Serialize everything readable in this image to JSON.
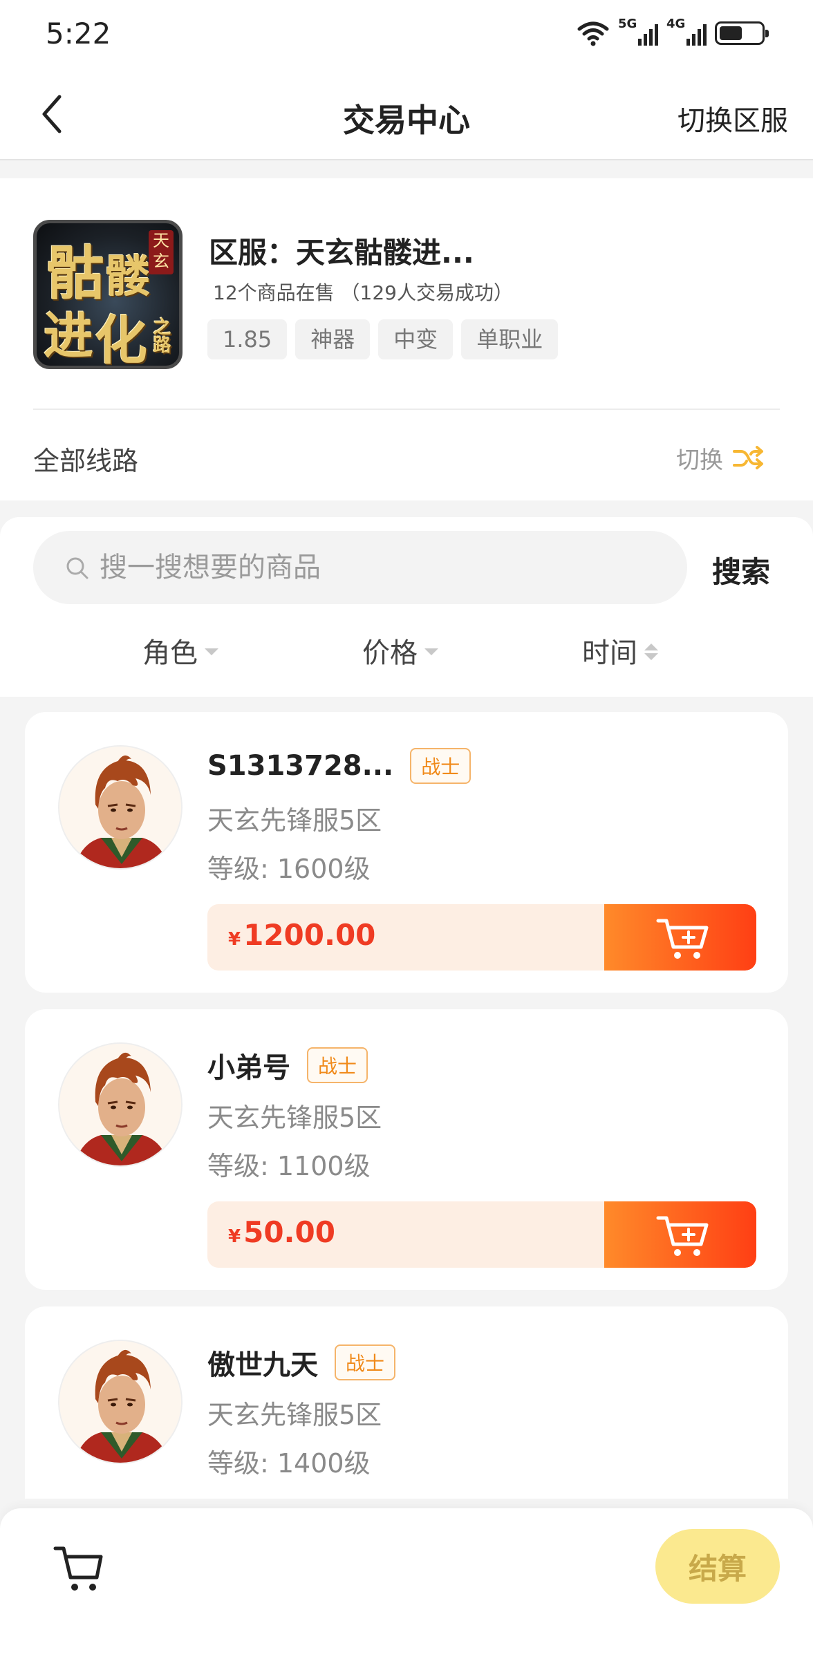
{
  "status": {
    "time": "5:22",
    "net1": "5G",
    "net2": "4G",
    "battery_level": 0.55
  },
  "nav": {
    "title": "交易中心",
    "right_action": "切换区服"
  },
  "server": {
    "logo_text": [
      "骷",
      "髅",
      "进",
      "化"
    ],
    "logo_badge": "天玄",
    "logo_sub": "之路",
    "name": "区服：天玄骷髅进...",
    "stats": "12个商品在售 （129人交易成功）",
    "tags": [
      "1.85",
      "神器",
      "中变",
      "单职业"
    ],
    "lines_label": "全部线路",
    "switch_label": "切换"
  },
  "search": {
    "placeholder": "搜一搜想要的商品",
    "value": "",
    "button": "搜索"
  },
  "sorts": [
    {
      "label": "角色"
    },
    {
      "label": "价格"
    },
    {
      "label": "时间"
    }
  ],
  "products": [
    {
      "name": "S1313728...",
      "role": "战士",
      "server": "天玄先锋服5区",
      "level": "等级: 1600级",
      "currency": "¥",
      "price": "1200.00"
    },
    {
      "name": "小弟号",
      "role": "战士",
      "server": "天玄先锋服5区",
      "level": "等级: 1100级",
      "currency": "¥",
      "price": "50.00"
    },
    {
      "name": "傲世九天",
      "role": "战士",
      "server": "天玄先锋服5区",
      "level": "等级: 1400级",
      "currency": "¥",
      "price": ""
    }
  ],
  "bottom": {
    "checkout": "结算"
  },
  "colors": {
    "accent": "#ef3b23",
    "cart_gradient_start": "#ff8a2a",
    "cart_gradient_end": "#ff3f14",
    "checkout_bg": "#fbe98f",
    "role_tag": "#f08a1a"
  }
}
